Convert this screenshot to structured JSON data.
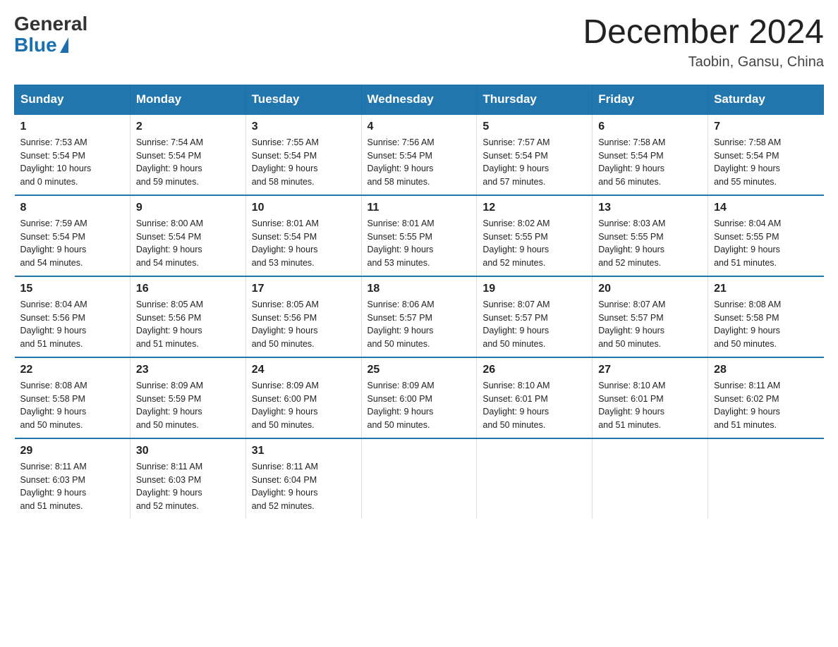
{
  "logo": {
    "general": "General",
    "blue": "Blue"
  },
  "header": {
    "title": "December 2024",
    "location": "Taobin, Gansu, China"
  },
  "columns": [
    "Sunday",
    "Monday",
    "Tuesday",
    "Wednesday",
    "Thursday",
    "Friday",
    "Saturday"
  ],
  "weeks": [
    [
      {
        "day": "1",
        "info": "Sunrise: 7:53 AM\nSunset: 5:54 PM\nDaylight: 10 hours\nand 0 minutes."
      },
      {
        "day": "2",
        "info": "Sunrise: 7:54 AM\nSunset: 5:54 PM\nDaylight: 9 hours\nand 59 minutes."
      },
      {
        "day": "3",
        "info": "Sunrise: 7:55 AM\nSunset: 5:54 PM\nDaylight: 9 hours\nand 58 minutes."
      },
      {
        "day": "4",
        "info": "Sunrise: 7:56 AM\nSunset: 5:54 PM\nDaylight: 9 hours\nand 58 minutes."
      },
      {
        "day": "5",
        "info": "Sunrise: 7:57 AM\nSunset: 5:54 PM\nDaylight: 9 hours\nand 57 minutes."
      },
      {
        "day": "6",
        "info": "Sunrise: 7:58 AM\nSunset: 5:54 PM\nDaylight: 9 hours\nand 56 minutes."
      },
      {
        "day": "7",
        "info": "Sunrise: 7:58 AM\nSunset: 5:54 PM\nDaylight: 9 hours\nand 55 minutes."
      }
    ],
    [
      {
        "day": "8",
        "info": "Sunrise: 7:59 AM\nSunset: 5:54 PM\nDaylight: 9 hours\nand 54 minutes."
      },
      {
        "day": "9",
        "info": "Sunrise: 8:00 AM\nSunset: 5:54 PM\nDaylight: 9 hours\nand 54 minutes."
      },
      {
        "day": "10",
        "info": "Sunrise: 8:01 AM\nSunset: 5:54 PM\nDaylight: 9 hours\nand 53 minutes."
      },
      {
        "day": "11",
        "info": "Sunrise: 8:01 AM\nSunset: 5:55 PM\nDaylight: 9 hours\nand 53 minutes."
      },
      {
        "day": "12",
        "info": "Sunrise: 8:02 AM\nSunset: 5:55 PM\nDaylight: 9 hours\nand 52 minutes."
      },
      {
        "day": "13",
        "info": "Sunrise: 8:03 AM\nSunset: 5:55 PM\nDaylight: 9 hours\nand 52 minutes."
      },
      {
        "day": "14",
        "info": "Sunrise: 8:04 AM\nSunset: 5:55 PM\nDaylight: 9 hours\nand 51 minutes."
      }
    ],
    [
      {
        "day": "15",
        "info": "Sunrise: 8:04 AM\nSunset: 5:56 PM\nDaylight: 9 hours\nand 51 minutes."
      },
      {
        "day": "16",
        "info": "Sunrise: 8:05 AM\nSunset: 5:56 PM\nDaylight: 9 hours\nand 51 minutes."
      },
      {
        "day": "17",
        "info": "Sunrise: 8:05 AM\nSunset: 5:56 PM\nDaylight: 9 hours\nand 50 minutes."
      },
      {
        "day": "18",
        "info": "Sunrise: 8:06 AM\nSunset: 5:57 PM\nDaylight: 9 hours\nand 50 minutes."
      },
      {
        "day": "19",
        "info": "Sunrise: 8:07 AM\nSunset: 5:57 PM\nDaylight: 9 hours\nand 50 minutes."
      },
      {
        "day": "20",
        "info": "Sunrise: 8:07 AM\nSunset: 5:57 PM\nDaylight: 9 hours\nand 50 minutes."
      },
      {
        "day": "21",
        "info": "Sunrise: 8:08 AM\nSunset: 5:58 PM\nDaylight: 9 hours\nand 50 minutes."
      }
    ],
    [
      {
        "day": "22",
        "info": "Sunrise: 8:08 AM\nSunset: 5:58 PM\nDaylight: 9 hours\nand 50 minutes."
      },
      {
        "day": "23",
        "info": "Sunrise: 8:09 AM\nSunset: 5:59 PM\nDaylight: 9 hours\nand 50 minutes."
      },
      {
        "day": "24",
        "info": "Sunrise: 8:09 AM\nSunset: 6:00 PM\nDaylight: 9 hours\nand 50 minutes."
      },
      {
        "day": "25",
        "info": "Sunrise: 8:09 AM\nSunset: 6:00 PM\nDaylight: 9 hours\nand 50 minutes."
      },
      {
        "day": "26",
        "info": "Sunrise: 8:10 AM\nSunset: 6:01 PM\nDaylight: 9 hours\nand 50 minutes."
      },
      {
        "day": "27",
        "info": "Sunrise: 8:10 AM\nSunset: 6:01 PM\nDaylight: 9 hours\nand 51 minutes."
      },
      {
        "day": "28",
        "info": "Sunrise: 8:11 AM\nSunset: 6:02 PM\nDaylight: 9 hours\nand 51 minutes."
      }
    ],
    [
      {
        "day": "29",
        "info": "Sunrise: 8:11 AM\nSunset: 6:03 PM\nDaylight: 9 hours\nand 51 minutes."
      },
      {
        "day": "30",
        "info": "Sunrise: 8:11 AM\nSunset: 6:03 PM\nDaylight: 9 hours\nand 52 minutes."
      },
      {
        "day": "31",
        "info": "Sunrise: 8:11 AM\nSunset: 6:04 PM\nDaylight: 9 hours\nand 52 minutes."
      },
      null,
      null,
      null,
      null
    ]
  ]
}
